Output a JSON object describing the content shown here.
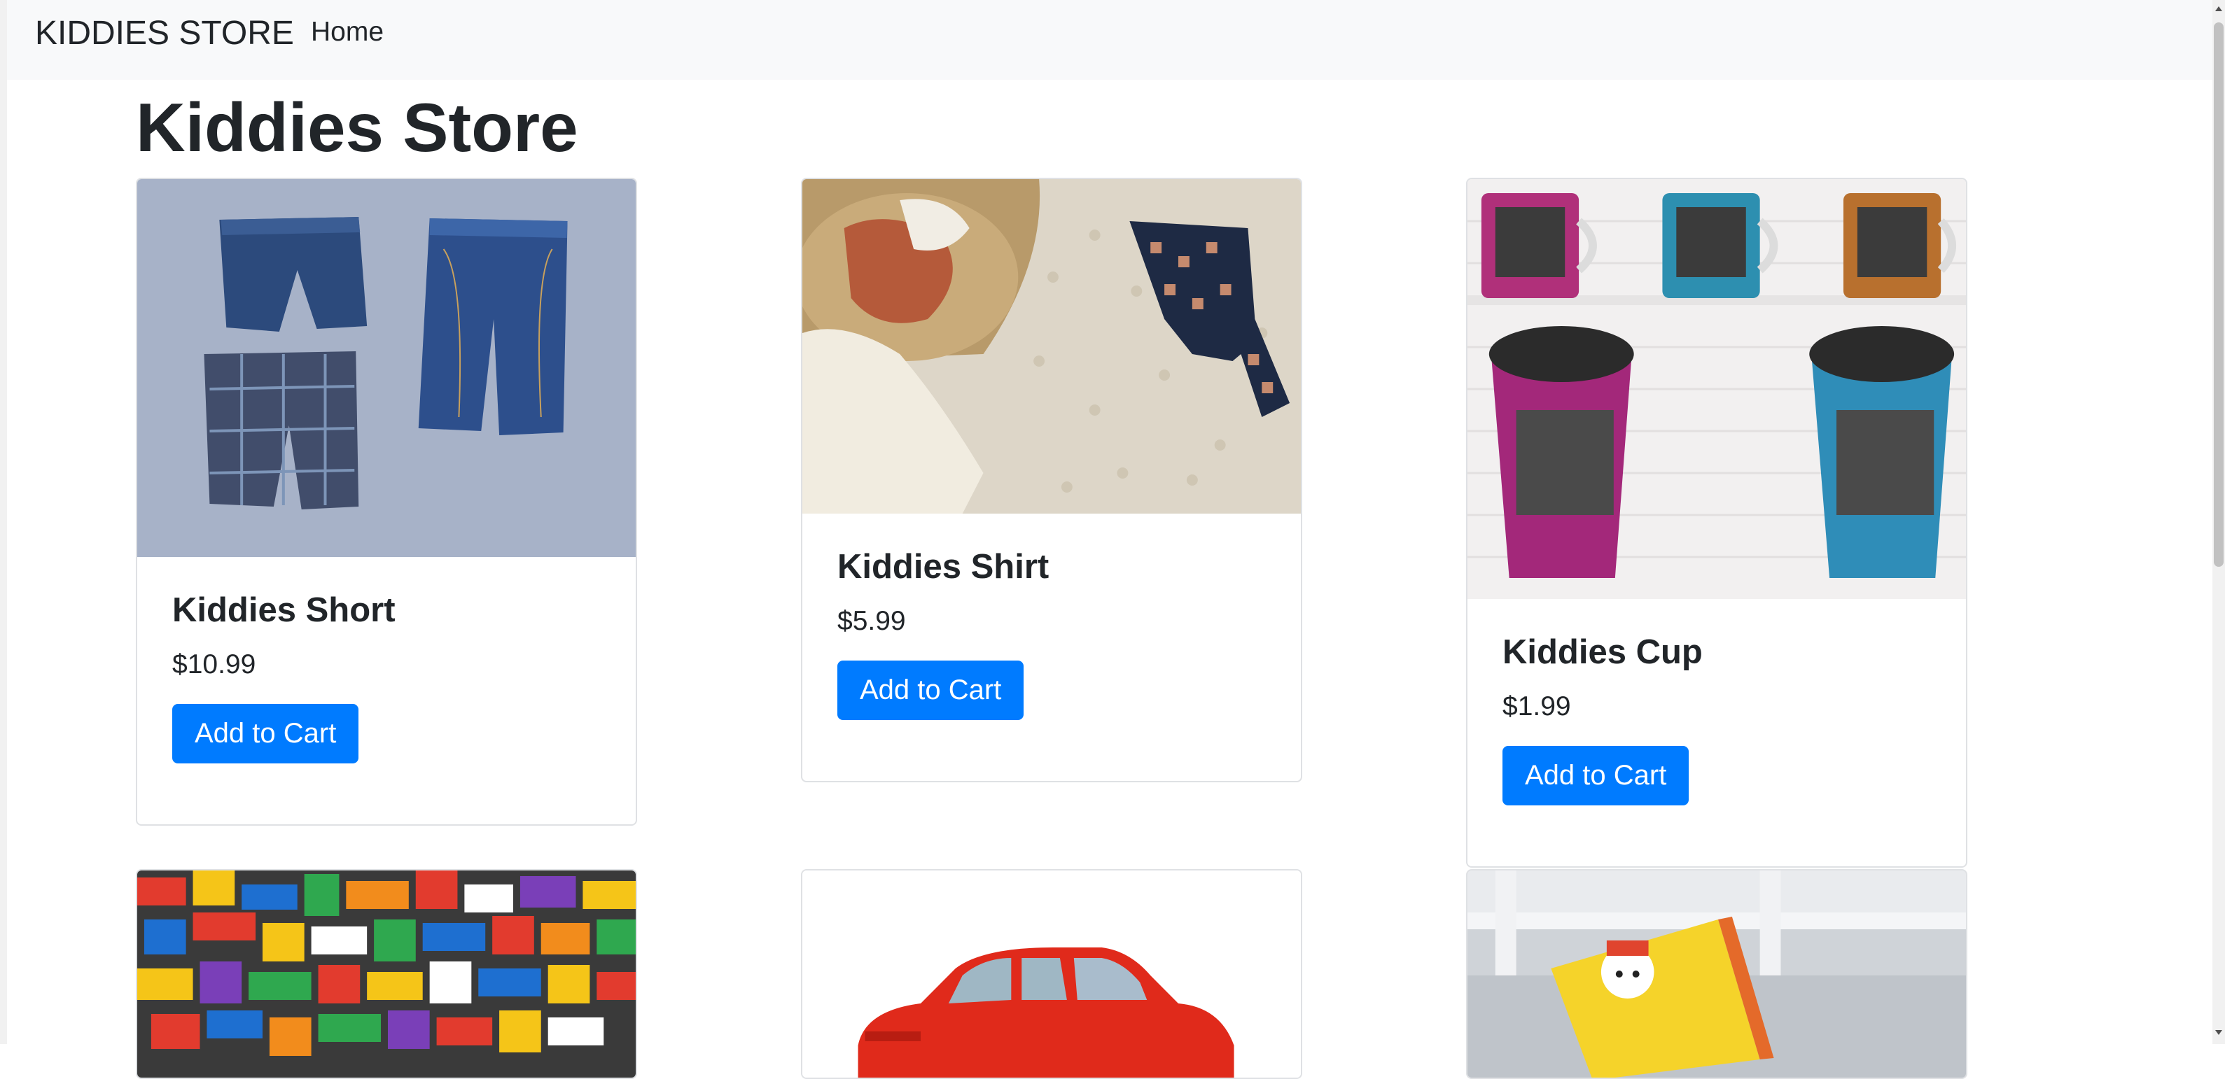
{
  "navbar": {
    "brand": "KIDDIES STORE",
    "links": [
      {
        "label": "Home"
      }
    ]
  },
  "page": {
    "title": "Kiddies Store"
  },
  "products": [
    {
      "name": "Kiddies Short",
      "price": "$10.99",
      "button": "Add to Cart",
      "image": "denim-shorts-photo"
    },
    {
      "name": "Kiddies Shirt",
      "price": "$5.99",
      "button": "Add to Cart",
      "image": "folded-clothes-photo"
    },
    {
      "name": "Kiddies Cup",
      "price": "$1.99",
      "button": "Add to Cart",
      "image": "mugs-and-travel-cups-photo"
    },
    {
      "image": "lego-bricks-photo"
    },
    {
      "image": "red-toy-car-photo"
    },
    {
      "image": "window-sill-book-photo"
    }
  ],
  "colors": {
    "navbar_bg": "#f8f9fa",
    "primary_button": "#007bff",
    "text": "#212529"
  }
}
